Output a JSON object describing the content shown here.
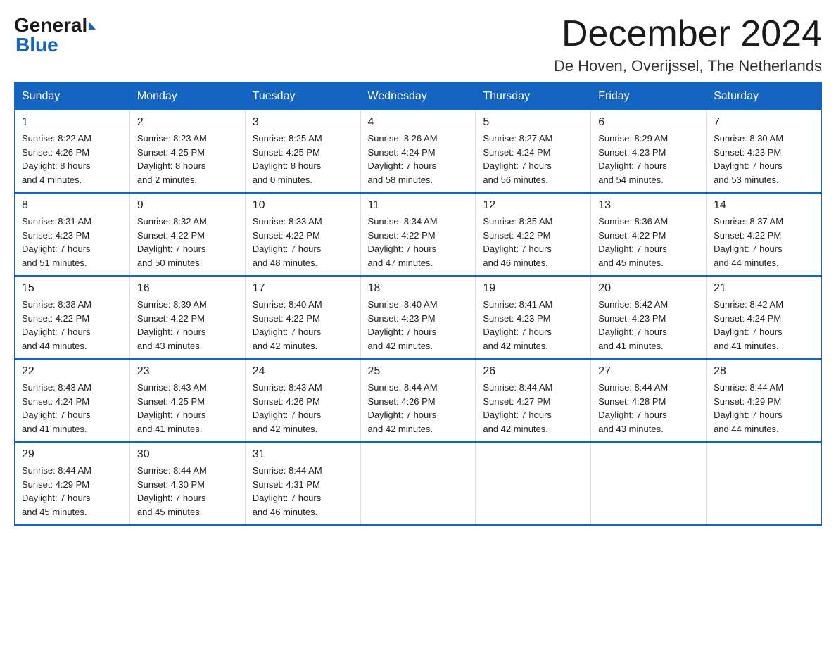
{
  "header": {
    "logo": {
      "general": "General",
      "blue": "Blue"
    },
    "title": "December 2024",
    "location": "De Hoven, Overijssel, The Netherlands"
  },
  "weekdays": [
    "Sunday",
    "Monday",
    "Tuesday",
    "Wednesday",
    "Thursday",
    "Friday",
    "Saturday"
  ],
  "weeks": [
    [
      {
        "day": "1",
        "sunrise": "8:22 AM",
        "sunset": "4:26 PM",
        "daylight": "8 hours and 4 minutes."
      },
      {
        "day": "2",
        "sunrise": "8:23 AM",
        "sunset": "4:25 PM",
        "daylight": "8 hours and 2 minutes."
      },
      {
        "day": "3",
        "sunrise": "8:25 AM",
        "sunset": "4:25 PM",
        "daylight": "8 hours and 0 minutes."
      },
      {
        "day": "4",
        "sunrise": "8:26 AM",
        "sunset": "4:24 PM",
        "daylight": "7 hours and 58 minutes."
      },
      {
        "day": "5",
        "sunrise": "8:27 AM",
        "sunset": "4:24 PM",
        "daylight": "7 hours and 56 minutes."
      },
      {
        "day": "6",
        "sunrise": "8:29 AM",
        "sunset": "4:23 PM",
        "daylight": "7 hours and 54 minutes."
      },
      {
        "day": "7",
        "sunrise": "8:30 AM",
        "sunset": "4:23 PM",
        "daylight": "7 hours and 53 minutes."
      }
    ],
    [
      {
        "day": "8",
        "sunrise": "8:31 AM",
        "sunset": "4:23 PM",
        "daylight": "7 hours and 51 minutes."
      },
      {
        "day": "9",
        "sunrise": "8:32 AM",
        "sunset": "4:22 PM",
        "daylight": "7 hours and 50 minutes."
      },
      {
        "day": "10",
        "sunrise": "8:33 AM",
        "sunset": "4:22 PM",
        "daylight": "7 hours and 48 minutes."
      },
      {
        "day": "11",
        "sunrise": "8:34 AM",
        "sunset": "4:22 PM",
        "daylight": "7 hours and 47 minutes."
      },
      {
        "day": "12",
        "sunrise": "8:35 AM",
        "sunset": "4:22 PM",
        "daylight": "7 hours and 46 minutes."
      },
      {
        "day": "13",
        "sunrise": "8:36 AM",
        "sunset": "4:22 PM",
        "daylight": "7 hours and 45 minutes."
      },
      {
        "day": "14",
        "sunrise": "8:37 AM",
        "sunset": "4:22 PM",
        "daylight": "7 hours and 44 minutes."
      }
    ],
    [
      {
        "day": "15",
        "sunrise": "8:38 AM",
        "sunset": "4:22 PM",
        "daylight": "7 hours and 44 minutes."
      },
      {
        "day": "16",
        "sunrise": "8:39 AM",
        "sunset": "4:22 PM",
        "daylight": "7 hours and 43 minutes."
      },
      {
        "day": "17",
        "sunrise": "8:40 AM",
        "sunset": "4:22 PM",
        "daylight": "7 hours and 42 minutes."
      },
      {
        "day": "18",
        "sunrise": "8:40 AM",
        "sunset": "4:23 PM",
        "daylight": "7 hours and 42 minutes."
      },
      {
        "day": "19",
        "sunrise": "8:41 AM",
        "sunset": "4:23 PM",
        "daylight": "7 hours and 42 minutes."
      },
      {
        "day": "20",
        "sunrise": "8:42 AM",
        "sunset": "4:23 PM",
        "daylight": "7 hours and 41 minutes."
      },
      {
        "day": "21",
        "sunrise": "8:42 AM",
        "sunset": "4:24 PM",
        "daylight": "7 hours and 41 minutes."
      }
    ],
    [
      {
        "day": "22",
        "sunrise": "8:43 AM",
        "sunset": "4:24 PM",
        "daylight": "7 hours and 41 minutes."
      },
      {
        "day": "23",
        "sunrise": "8:43 AM",
        "sunset": "4:25 PM",
        "daylight": "7 hours and 41 minutes."
      },
      {
        "day": "24",
        "sunrise": "8:43 AM",
        "sunset": "4:26 PM",
        "daylight": "7 hours and 42 minutes."
      },
      {
        "day": "25",
        "sunrise": "8:44 AM",
        "sunset": "4:26 PM",
        "daylight": "7 hours and 42 minutes."
      },
      {
        "day": "26",
        "sunrise": "8:44 AM",
        "sunset": "4:27 PM",
        "daylight": "7 hours and 42 minutes."
      },
      {
        "day": "27",
        "sunrise": "8:44 AM",
        "sunset": "4:28 PM",
        "daylight": "7 hours and 43 minutes."
      },
      {
        "day": "28",
        "sunrise": "8:44 AM",
        "sunset": "4:29 PM",
        "daylight": "7 hours and 44 minutes."
      }
    ],
    [
      {
        "day": "29",
        "sunrise": "8:44 AM",
        "sunset": "4:29 PM",
        "daylight": "7 hours and 45 minutes."
      },
      {
        "day": "30",
        "sunrise": "8:44 AM",
        "sunset": "4:30 PM",
        "daylight": "7 hours and 45 minutes."
      },
      {
        "day": "31",
        "sunrise": "8:44 AM",
        "sunset": "4:31 PM",
        "daylight": "7 hours and 46 minutes."
      },
      null,
      null,
      null,
      null
    ]
  ],
  "labels": {
    "sunrise": "Sunrise:",
    "sunset": "Sunset:",
    "daylight": "Daylight:"
  }
}
